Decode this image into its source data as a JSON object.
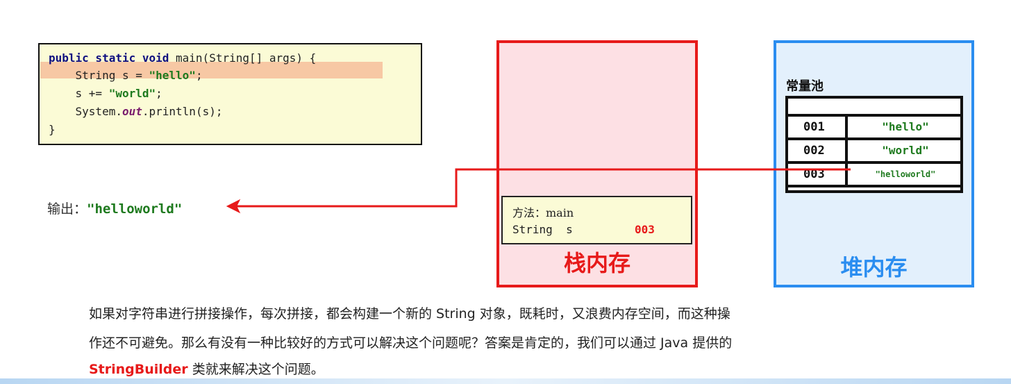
{
  "code": {
    "line1": {
      "kw": "public static void",
      "rest": " main(String[] args) {"
    },
    "line2": {
      "pre": "    String s = ",
      "str": "\"hello\"",
      "post": ";"
    },
    "line3": {
      "pre": "    s += ",
      "str": "\"world\"",
      "post": ";"
    },
    "line4": {
      "pre": "    System.",
      "field": "out",
      "post": ".println(s);"
    },
    "line5": "}"
  },
  "output": {
    "label": "输出：",
    "value": "\"helloworld\""
  },
  "stack": {
    "title": "栈内存",
    "frame": {
      "method_line": "方法：main",
      "var_line": "String  s",
      "var_value": "003"
    }
  },
  "heap": {
    "title": "堆内存",
    "pool_title": "常量池",
    "pool_rows": [
      {
        "addr": "001",
        "value": "\"hello\""
      },
      {
        "addr": "002",
        "value": "\"world\""
      },
      {
        "addr": "003",
        "value": "\"helloworld\""
      }
    ]
  },
  "paragraph": {
    "line1": "如果对字符串进行拼接操作，每次拼接，都会构建一个新的 String 对象，既耗时，又浪费内存空间，而这种操",
    "line2": "作还不可避免。那么有没有一种比较好的方式可以解决这个问题呢？答案是肯定的，我们可以通过 Java 提供的",
    "highlight": "StringBuilder",
    "line3_rest": " 类就来解决这个问题。"
  },
  "colors": {
    "stack_accent": "#e71a1a",
    "heap_accent": "#2a8df0",
    "string_green": "#1e7a1e",
    "keyword_navy": "#101080"
  }
}
